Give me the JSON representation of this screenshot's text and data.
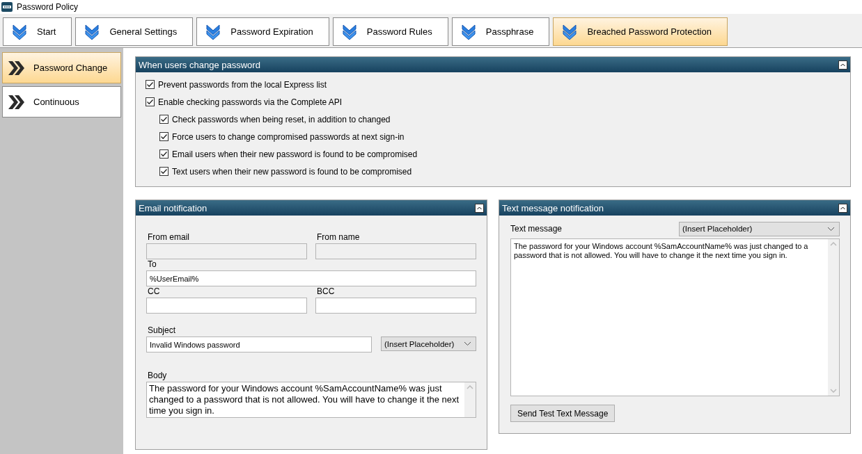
{
  "window": {
    "title": "Password Policy"
  },
  "tabs": [
    {
      "label": "Start",
      "selected": false
    },
    {
      "label": "General Settings",
      "selected": false
    },
    {
      "label": "Password Expiration",
      "selected": false
    },
    {
      "label": "Password Rules",
      "selected": false
    },
    {
      "label": "Passphrase",
      "selected": false
    },
    {
      "label": "Breached Password Protection",
      "selected": true
    }
  ],
  "sidebar": {
    "items": [
      {
        "label": "Password Change",
        "selected": true
      },
      {
        "label": "Continuous",
        "selected": false
      }
    ]
  },
  "change_panel": {
    "title": "When users change password",
    "options": [
      {
        "label": "Prevent passwords from the local Express list",
        "checked": true
      },
      {
        "label": "Enable checking passwords via the Complete API",
        "checked": true,
        "children": [
          {
            "label": "Check passwords when being reset, in addition to changed",
            "checked": true
          },
          {
            "label": "Force users to change compromised passwords at next sign-in",
            "checked": true
          },
          {
            "label": "Email users when their new password is found to be compromised",
            "checked": true
          },
          {
            "label": "Text users when their new password is found to be compromised",
            "checked": true
          }
        ]
      }
    ]
  },
  "email_panel": {
    "title": "Email notification",
    "from_email": {
      "label": "From email",
      "disabled": true
    },
    "from_name": {
      "label": "From name",
      "disabled": true
    },
    "to": {
      "label": "To",
      "value": "%UserEmail%",
      "disabled": false
    },
    "cc": {
      "label": "CC",
      "disabled": false
    },
    "bcc": {
      "label": "BCC",
      "disabled": false
    },
    "subject": {
      "label": "Subject",
      "value": "Invalid Windows password",
      "disabled": false
    },
    "subject_placeholder_dropdown": "(Insert Placeholder)",
    "body": {
      "label": "Body",
      "value": "The password for your Windows account %SamAccountName% was just changed to a password that is not allowed. You will have to change it the next time you sign in."
    }
  },
  "text_panel": {
    "title": "Text message notification",
    "label": "Text message",
    "placeholder_dropdown": "(Insert Placeholder)",
    "message": "The password for your Windows account %SamAccountName% was just changed to a password that is not allowed. You will have to change it the next time you sign in.",
    "button": "Send Test Text Message"
  }
}
